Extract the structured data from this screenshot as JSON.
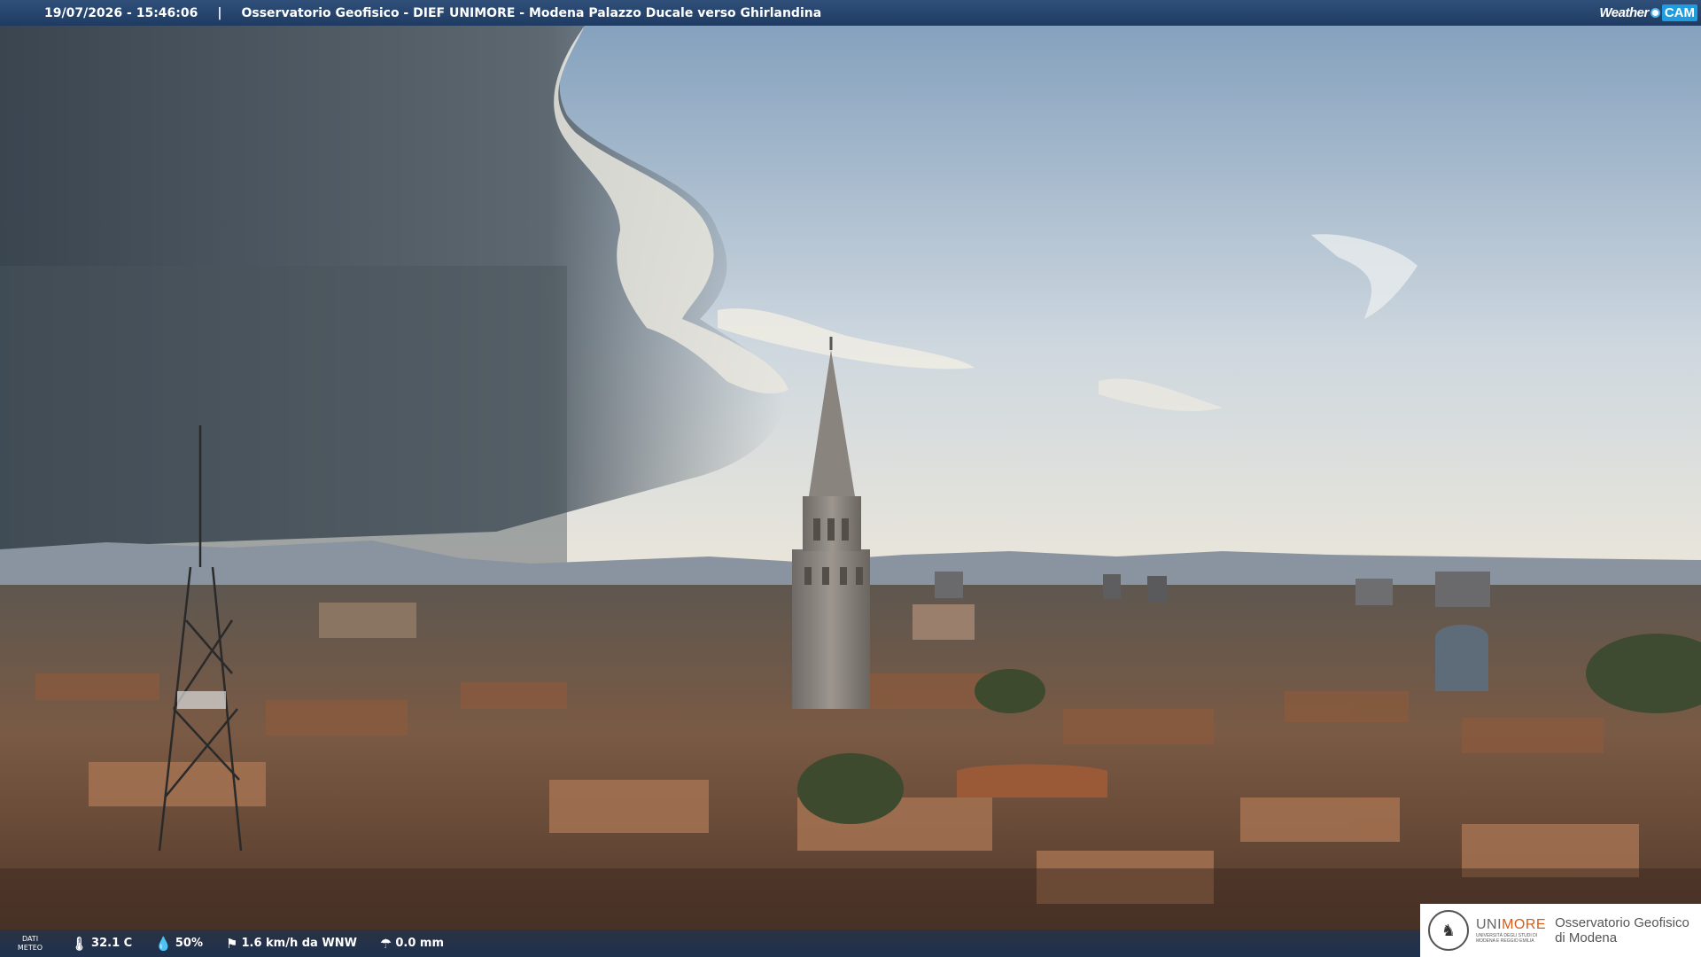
{
  "header": {
    "timestamp": "19/07/2026 - 15:46:06",
    "separator": "|",
    "location": "Osservatorio Geofisico - DIEF UNIMORE - Modena Palazzo Ducale verso Ghirlandina",
    "brand_weather": "Weather",
    "brand_cam": "CAM"
  },
  "weather": {
    "label_line1": "DATI",
    "label_line2": "METEO",
    "temperature": "32.1 C",
    "humidity": "50%",
    "wind": "1.6 km/h da WNW",
    "rain": "0.0 mm",
    "icons": [
      "thermometer-icon",
      "humidity-icon",
      "wind-icon",
      "rain-gauge-icon"
    ]
  },
  "logo": {
    "uni_prefix": "UNI",
    "uni_suffix": "MORE",
    "uni_sub": "UNIVERSITÀ DEGLI STUDI DI MODENA E REGGIO EMILIA",
    "obs_line1": "Osservatorio Geofisico",
    "obs_line2": "di Modena"
  },
  "colors": {
    "header_bg": "#27456e",
    "accent_orange": "#d85b17",
    "brand_blue": "#1f9be0"
  }
}
